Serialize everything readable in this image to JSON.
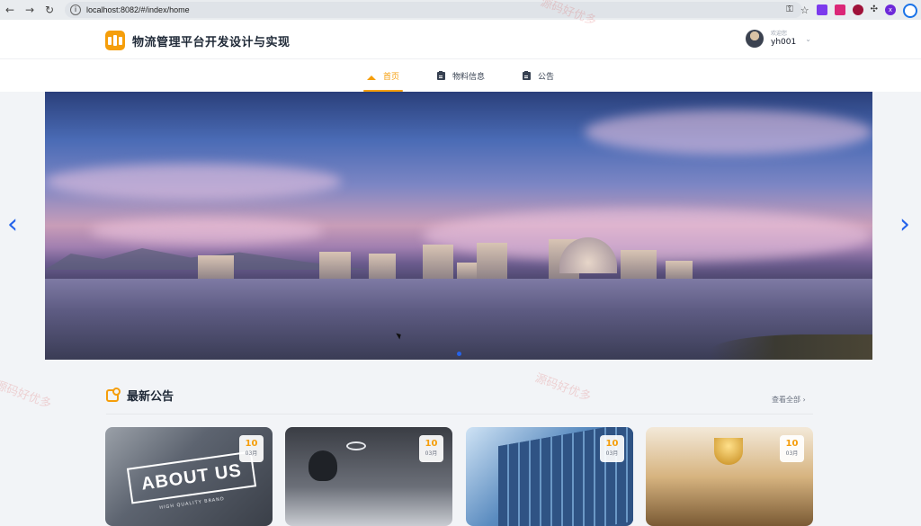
{
  "browser": {
    "url": "localhost:8082/#/index/home",
    "profile_initial": "x"
  },
  "header": {
    "site_title": "物流管理平台开发设计与实现",
    "welcome": "欢迎您",
    "username": "yh001"
  },
  "nav": {
    "items": [
      {
        "label": "首页",
        "active": true
      },
      {
        "label": "物料信息",
        "active": false
      },
      {
        "label": "公告",
        "active": false
      }
    ]
  },
  "carousel": {
    "prev_label": "‹",
    "next_label": "›",
    "active_slide": 1,
    "slide_count": 1
  },
  "notices": {
    "title": "最新公告",
    "view_all": "查看全部 ›",
    "cards": [
      {
        "day": "10",
        "month": "03月",
        "overlay_text": "ABOUT US",
        "overlay_sub": "HIGH QUALITY BRAND"
      },
      {
        "day": "10",
        "month": "03月"
      },
      {
        "day": "10",
        "month": "03月"
      },
      {
        "day": "10",
        "month": "03月"
      }
    ]
  },
  "watermark": "源码好优多",
  "colors": {
    "accent": "#f59e0b",
    "link_blue": "#2563eb"
  }
}
